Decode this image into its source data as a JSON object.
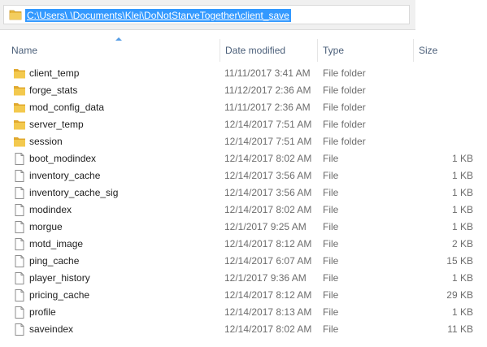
{
  "address": {
    "path": "C:\\Users\\                  \\Documents\\Klei\\DoNotStarveTogether\\client_save"
  },
  "columns": {
    "name": "Name",
    "date": "Date modified",
    "type": "Type",
    "size": "Size"
  },
  "colors": {
    "folder": "#e8b83c",
    "selection": "#3399ff",
    "header_text": "#4c607a"
  },
  "items": [
    {
      "name": "client_temp",
      "date": "11/11/2017 3:41 AM",
      "type": "File folder",
      "size": "",
      "icon": "folder-icon"
    },
    {
      "name": "forge_stats",
      "date": "11/12/2017 2:36 AM",
      "type": "File folder",
      "size": "",
      "icon": "folder-icon"
    },
    {
      "name": "mod_config_data",
      "date": "11/11/2017 2:36 AM",
      "type": "File folder",
      "size": "",
      "icon": "folder-icon"
    },
    {
      "name": "server_temp",
      "date": "12/14/2017 7:51 AM",
      "type": "File folder",
      "size": "",
      "icon": "folder-icon"
    },
    {
      "name": "session",
      "date": "12/14/2017 7:51 AM",
      "type": "File folder",
      "size": "",
      "icon": "folder-icon"
    },
    {
      "name": "boot_modindex",
      "date": "12/14/2017 8:02 AM",
      "type": "File",
      "size": "1 KB",
      "icon": "file-icon"
    },
    {
      "name": "inventory_cache",
      "date": "12/14/2017 3:56 AM",
      "type": "File",
      "size": "1 KB",
      "icon": "file-icon"
    },
    {
      "name": "inventory_cache_sig",
      "date": "12/14/2017 3:56 AM",
      "type": "File",
      "size": "1 KB",
      "icon": "file-icon"
    },
    {
      "name": "modindex",
      "date": "12/14/2017 8:02 AM",
      "type": "File",
      "size": "1 KB",
      "icon": "file-icon"
    },
    {
      "name": "morgue",
      "date": "12/1/2017 9:25 AM",
      "type": "File",
      "size": "1 KB",
      "icon": "file-icon"
    },
    {
      "name": "motd_image",
      "date": "12/14/2017 8:12 AM",
      "type": "File",
      "size": "2 KB",
      "icon": "file-icon"
    },
    {
      "name": "ping_cache",
      "date": "12/14/2017 6:07 AM",
      "type": "File",
      "size": "15 KB",
      "icon": "file-icon"
    },
    {
      "name": "player_history",
      "date": "12/1/2017 9:36 AM",
      "type": "File",
      "size": "1 KB",
      "icon": "file-icon"
    },
    {
      "name": "pricing_cache",
      "date": "12/14/2017 8:12 AM",
      "type": "File",
      "size": "29 KB",
      "icon": "file-icon"
    },
    {
      "name": "profile",
      "date": "12/14/2017 8:13 AM",
      "type": "File",
      "size": "1 KB",
      "icon": "file-icon"
    },
    {
      "name": "saveindex",
      "date": "12/14/2017 8:02 AM",
      "type": "File",
      "size": "11 KB",
      "icon": "file-icon"
    }
  ]
}
